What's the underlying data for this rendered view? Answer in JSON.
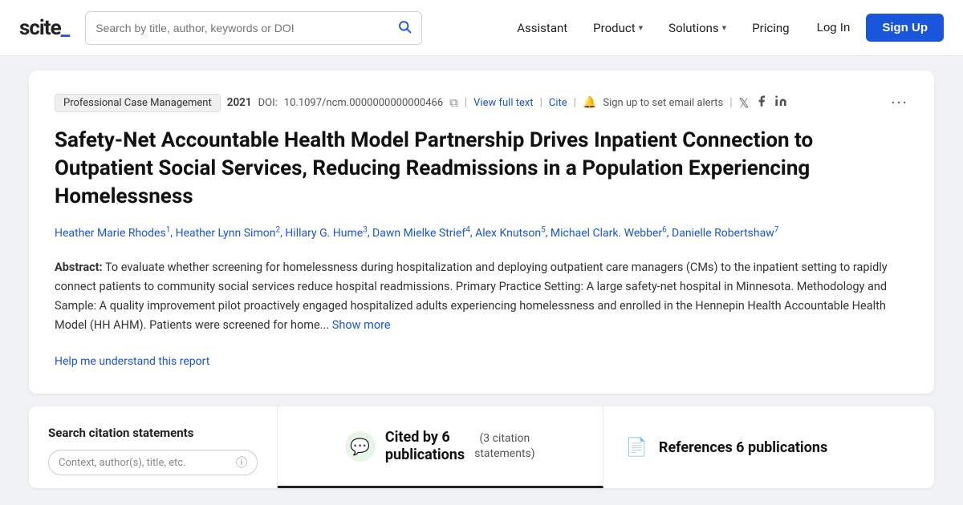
{
  "header": {
    "logo": "scite",
    "logo_underscore": "_",
    "search_placeholder": "Search by title, author, keywords or DOI",
    "nav": [
      {
        "label": "Assistant",
        "has_dropdown": false
      },
      {
        "label": "Product",
        "has_dropdown": true
      },
      {
        "label": "Solutions",
        "has_dropdown": true
      },
      {
        "label": "Pricing",
        "has_dropdown": false
      }
    ],
    "login_label": "Log In",
    "signup_label": "Sign Up"
  },
  "article": {
    "journal": "Professional Case Management",
    "year": "2021",
    "doi_label": "DOI:",
    "doi_value": "10.1097/ncm.0000000000000466",
    "view_full_text": "View full text",
    "cite": "Cite",
    "alert_text": "Sign up to set email alerts",
    "title": "Safety-Net Accountable Health Model Partnership Drives Inpatient Connection to Outpatient Social Services, Reducing Readmissions in a Population Experiencing Homelessness",
    "authors": [
      {
        "name": "Heather Marie Rhodes",
        "sup": "1"
      },
      {
        "name": "Heather Lynn Simon",
        "sup": "2"
      },
      {
        "name": "Hillary G. Hume",
        "sup": "3"
      },
      {
        "name": "Dawn Mielke Strief",
        "sup": "4"
      },
      {
        "name": "Alex Knutson",
        "sup": "5"
      },
      {
        "name": "Michael Clark. Webber",
        "sup": "6"
      },
      {
        "name": "Danielle Robertshaw",
        "sup": "7"
      }
    ],
    "abstract_label": "Abstract:",
    "abstract_text": "To evaluate whether screening for homelessness during hospitalization and deploying outpatient care managers (CMs) to the inpatient setting to rapidly connect patients to community social services reduce hospital readmissions. Primary Practice Setting: A large safety-net hospital in Minnesota. Methodology and Sample: A quality improvement pilot proactively engaged hospitalized adults experiencing homelessness and enrolled in the Hennepin Health Accountable Health Model (HH AHM). Patients were screened for home...",
    "show_more": "Show more",
    "help_link": "Help me understand this report"
  },
  "bottom": {
    "search_section": {
      "title": "Search citation statements",
      "filter_placeholder": "Context, author(s), title, etc."
    },
    "cited_section": {
      "icon": "💬",
      "cited_text_line1": "Cited by 6",
      "cited_text_line2": "publications",
      "citation_statements_line1": "(3 citation",
      "citation_statements_line2": "statements)"
    },
    "references_section": {
      "icon": "📄",
      "text": "References 6 publications"
    }
  }
}
